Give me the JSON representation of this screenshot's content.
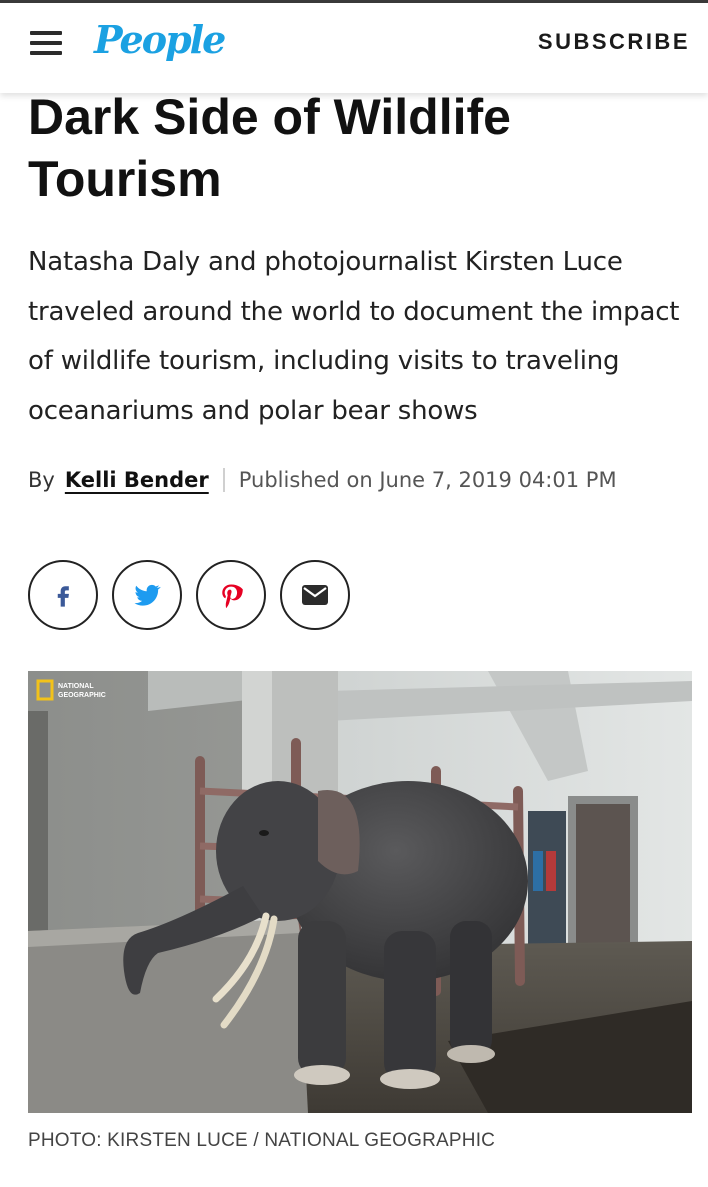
{
  "header": {
    "logo_text": "People",
    "subscribe_label": "SUBSCRIBE",
    "menu_icon": "hamburger-menu-icon"
  },
  "article": {
    "headline": "Dark Side of Wildlife Tourism",
    "dek": "Natasha Daly and photojournalist Kirsten Luce traveled around the world to document the impact of wildlife tourism, including visits to traveling oceanariums and polar bear shows",
    "byline_prefix": "By",
    "author": "Kelli Bender",
    "published": "Published on June 7, 2019 04:01 PM"
  },
  "share": [
    {
      "name": "facebook",
      "icon": "facebook-icon"
    },
    {
      "name": "twitter",
      "icon": "twitter-icon"
    },
    {
      "name": "pinterest",
      "icon": "pinterest-icon"
    },
    {
      "name": "email",
      "icon": "email-icon"
    }
  ],
  "photo": {
    "watermark": "NATIONAL GEOGRAPHIC",
    "caption": "PHOTO: KIRSTEN LUCE / NATIONAL GEOGRAPHIC"
  },
  "colors": {
    "brand_blue": "#1ba1e2",
    "text_dark": "#111111",
    "natgeo_yellow": "#f2c21a"
  }
}
